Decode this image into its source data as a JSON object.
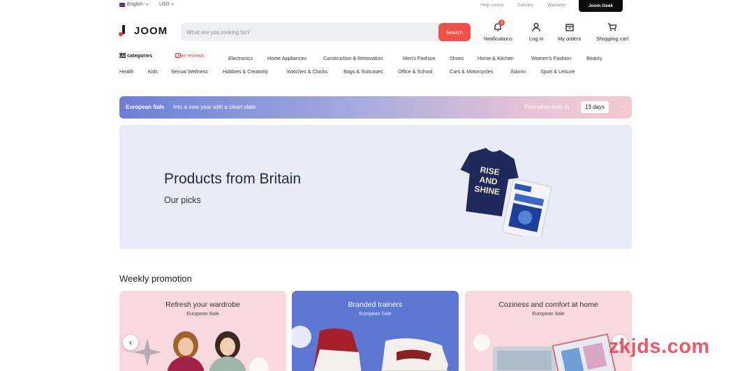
{
  "topbar": {
    "language": "English",
    "currency": "USD",
    "links": [
      "Help centre",
      "Delivery",
      "Warranty"
    ],
    "geek_button": "Joom Geek"
  },
  "header": {
    "logo": "JOOM",
    "search_placeholder": "What are you looking for?",
    "search_button": "Search",
    "notifications_label": "Notifications",
    "notifications_count": "1",
    "login_label": "Log in",
    "orders_label": "My orders",
    "cart_label": "Shopping cart"
  },
  "categories": {
    "all": "All categories",
    "reviews": "User reviews",
    "row1": [
      "Electronics",
      "Home Appliances",
      "Construction & Renovation",
      "Men's Fashion",
      "Shoes",
      "Home & Kitchen",
      "Women's Fashion",
      "Beauty"
    ],
    "row2": [
      "Health",
      "Kids",
      "Sexual Wellness",
      "Hobbies & Creativity",
      "Watches & Clocks",
      "Bags & Suitcases",
      "Office & School",
      "Cars & Motorcycles",
      "Xiaomi",
      "Sport & Leisure"
    ]
  },
  "promo": {
    "title": "European Sale",
    "subtitle": "Into a new year with a clean slate",
    "ends_label": "Promotion ends in",
    "days": "13 days"
  },
  "hero": {
    "title": "Products from Britain",
    "subtitle": "Our picks",
    "tshirt_text": [
      "RISE",
      "AND",
      "SHINE"
    ]
  },
  "weekly": {
    "title": "Weekly promotion",
    "cards": [
      {
        "title": "Refresh your wardrobe",
        "subtitle": "European Sale",
        "bg": "#f7d9df"
      },
      {
        "title": "Branded trainers",
        "subtitle": "European Sale",
        "bg": "#5d78d4"
      },
      {
        "title": "Coziness and comfort at home",
        "subtitle": "European Sale",
        "bg": "#f7d9df"
      }
    ]
  },
  "watermark": "zkjds.com",
  "colors": {
    "accent": "#f04f4a",
    "hero_bg": "#e9ebf6",
    "navy_shirt": "#1f2a5c"
  }
}
